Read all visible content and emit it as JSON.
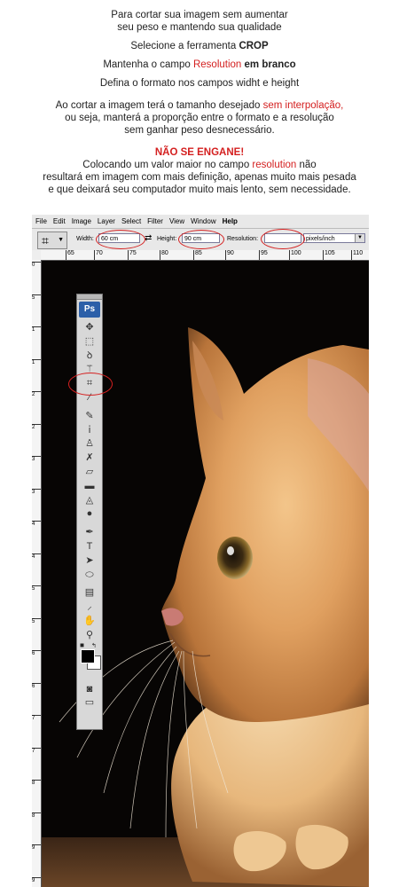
{
  "intro": {
    "l1": "Para cortar sua imagem sem aumentar",
    "l2": "seu peso e mantendo sua qualidade",
    "l3_pre": "Selecione a ferramenta ",
    "l3_bold": "CROP",
    "l4_pre": "Mantenha o campo ",
    "l4_red": "Resolution",
    "l4_bold": " em branco",
    "l5": "Defina o formato nos campos widht e height",
    "p2_pre": "Ao cortar a imagem terá o tamanho desejado ",
    "p2_red": "sem interpolação,",
    "p2_l2": "ou seja, manterá a proporção entre o formato e a resolução",
    "p2_l3": "sem ganhar peso desnecessário.",
    "warn": "NÃO SE ENGANE!",
    "p3_pre": "Colocando um valor maior no campo ",
    "p3_red": "resolution",
    "p3_post": " não",
    "p3_l2": "resultará em imagem com mais definição, apenas muito mais pesada",
    "p3_l3": "e que deixará seu computador muito mais lento, sem necessidade."
  },
  "app": {
    "menu": [
      "File",
      "Edit",
      "Image",
      "Layer",
      "Select",
      "Filter",
      "View",
      "Window",
      "Help"
    ],
    "options": {
      "width_label": "Width:",
      "width_value": "60 cm",
      "height_label": "Height:",
      "height_value": "90 cm",
      "resolution_label": "Resolution:",
      "resolution_value": "",
      "units_value": "pixels/inch"
    },
    "ruler_h": [
      "65",
      "70",
      "75",
      "80",
      "85",
      "90",
      "95",
      "100",
      "105",
      "110"
    ],
    "ruler_v": [
      "0",
      "5",
      "1",
      "1",
      "2",
      "2",
      "3",
      "3",
      "4",
      "4",
      "5",
      "5",
      "6",
      "6",
      "7",
      "7",
      "8",
      "8",
      "9",
      "9"
    ],
    "toolbox_logo": "Ps",
    "annotation_color": "#d42020"
  }
}
